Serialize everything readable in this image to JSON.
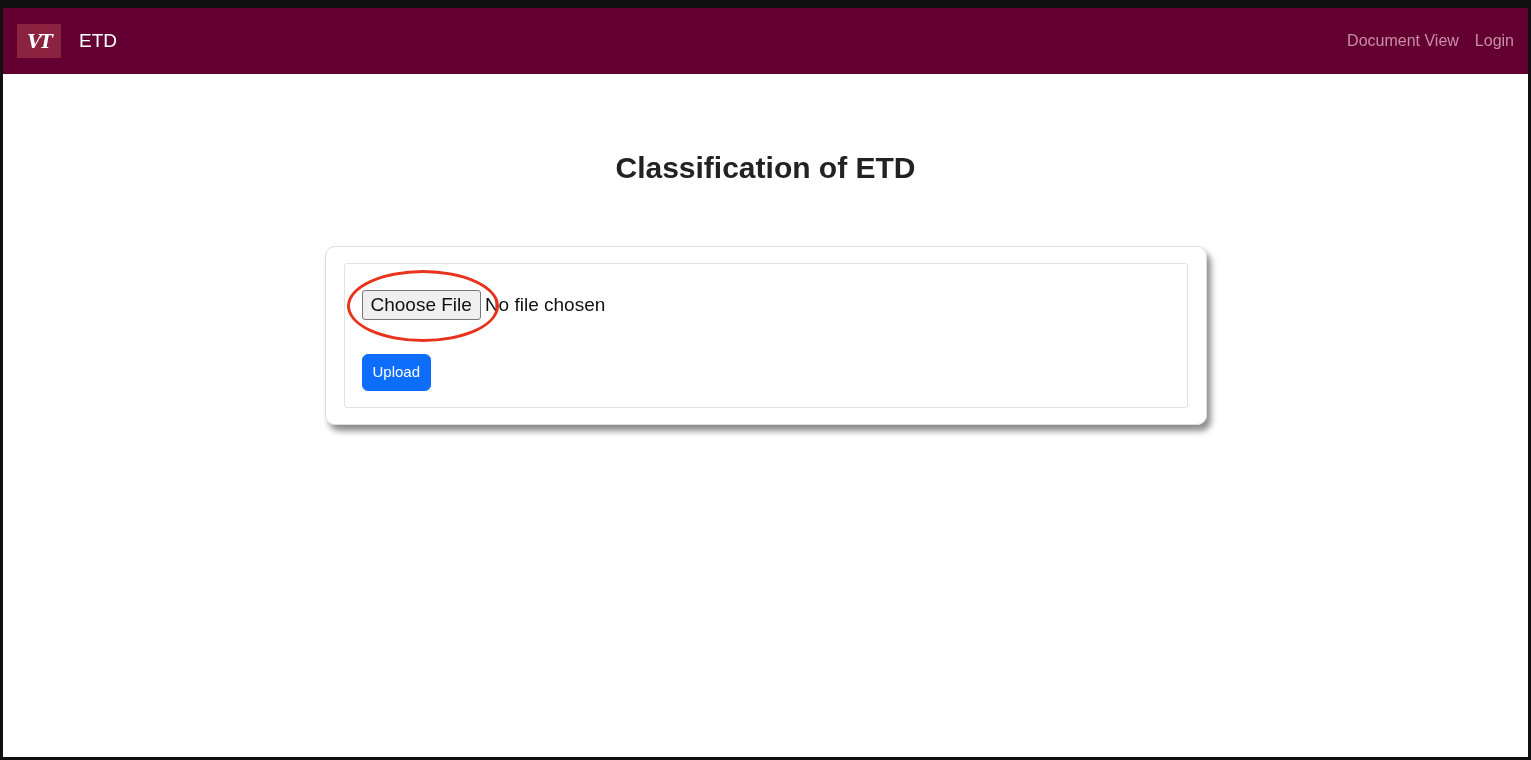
{
  "navbar": {
    "logo": "VT",
    "brand": "ETD",
    "links": [
      {
        "label": "Document View"
      },
      {
        "label": "Login"
      }
    ]
  },
  "title": "Classification of ETD",
  "upload_form": {
    "file_button": "Choose File",
    "file_status": "No file chosen",
    "submit": "Upload",
    "file_button_circled": true
  }
}
